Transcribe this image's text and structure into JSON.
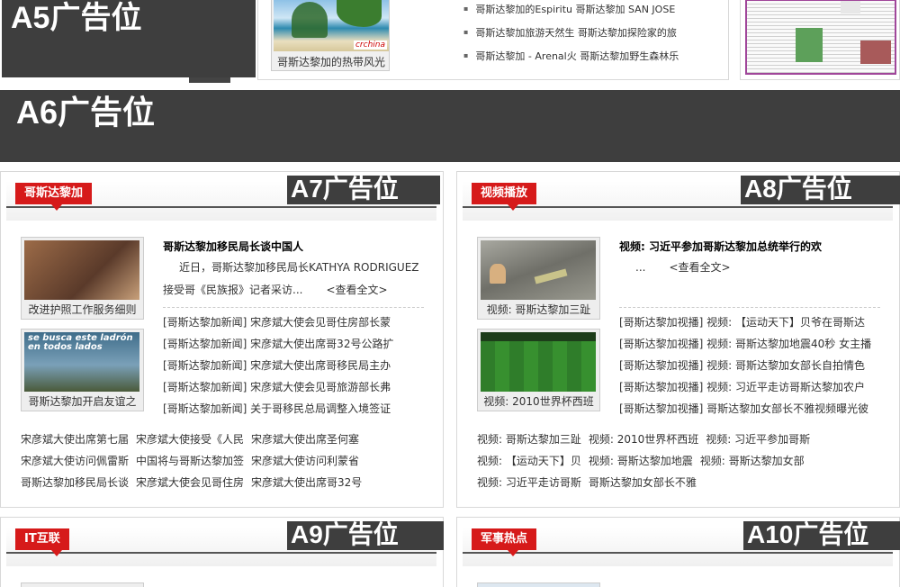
{
  "ads": {
    "a5": "A5广告位",
    "a6": "A6广告位",
    "a7": "A7广告位",
    "a8": "A8广告位",
    "a9": "A9广告位",
    "a10": "A10广告位"
  },
  "top": {
    "photo_caption": "哥斯达黎加的热带风光",
    "photo_watermark": "crchina",
    "bullets": [
      "哥斯达黎加的Espiritu 哥斯达黎加  SAN JOSE",
      "哥斯达黎加旅游天然生 哥斯达黎加探险家的旅",
      "哥斯达黎加 - Arenal火 哥斯达黎加野生森林乐"
    ]
  },
  "panels": [
    {
      "tag": "哥斯达黎加",
      "photos": [
        {
          "caption": "改进护照工作服务细则",
          "color": "#7a4a32"
        },
        {
          "caption": "哥斯达黎加开启友谊之",
          "color": "#3f6d8a",
          "sign": "se busca este ladrón en todos lados"
        }
      ],
      "headline": "哥斯达黎加移民局长谈中国人",
      "summary": "近日，哥斯达黎加移民局长KATHYA RODRIGUEZ接受哥《民族报》记者采访...",
      "more": "<查看全文>",
      "news": [
        "[哥斯达黎加新闻] 宋彦斌大使会见哥住房部长蒙",
        "[哥斯达黎加新闻] 宋彦斌大使出席哥32号公路扩",
        "[哥斯达黎加新闻] 宋彦斌大使出席哥移民局主办",
        "[哥斯达黎加新闻] 宋彦斌大使会见哥旅游部长弗",
        "[哥斯达黎加新闻] 关于哥移民总局调整入境签证"
      ],
      "bottom": [
        [
          "宋彦斌大使出席第七届",
          "宋彦斌大使接受《人民",
          "宋彦斌大使出席圣何塞"
        ],
        [
          "宋彦斌大使访问佩雷斯",
          "中国将与哥斯达黎加签",
          "宋彦斌大使访问利蒙省"
        ],
        [
          "哥斯达黎加移民局长谈",
          "宋彦斌大使会见哥住房",
          "宋彦斌大使出席哥32号"
        ]
      ]
    },
    {
      "tag": "视频播放",
      "photos": [
        {
          "caption": "视频: 哥斯达黎加三趾",
          "color": "#8c8c82"
        },
        {
          "caption": "视频: 2010世界杯西班",
          "color": "#2f7d2a"
        }
      ],
      "headline": "视频: 习近平参加哥斯达黎加总统举行的欢",
      "summary": "...",
      "more": "<查看全文>",
      "news": [
        "[哥斯达黎加视播] 视频: 【运动天下】贝爷在哥斯达",
        "[哥斯达黎加视播] 视频: 哥斯达黎加地震40秒 女主播",
        "[哥斯达黎加视播] 视频: 哥斯达黎加女部长自拍情色",
        "[哥斯达黎加视播] 视频: 习近平走访哥斯达黎加农户",
        "[哥斯达黎加视播] 哥斯达黎加女部长不雅视频曝光彼"
      ],
      "bottom": [
        [
          "视频: 哥斯达黎加三趾",
          "视频: 2010世界杯西班",
          "视频: 习近平参加哥斯"
        ],
        [
          "视频: 【运动天下】贝",
          "视频: 哥斯达黎加地震",
          "视频: 哥斯达黎加女部"
        ],
        [
          "视频: 习近平走访哥斯",
          "哥斯达黎加女部长不雅"
        ]
      ]
    }
  ],
  "lower_tags": [
    "IT互联",
    "军事热点"
  ]
}
